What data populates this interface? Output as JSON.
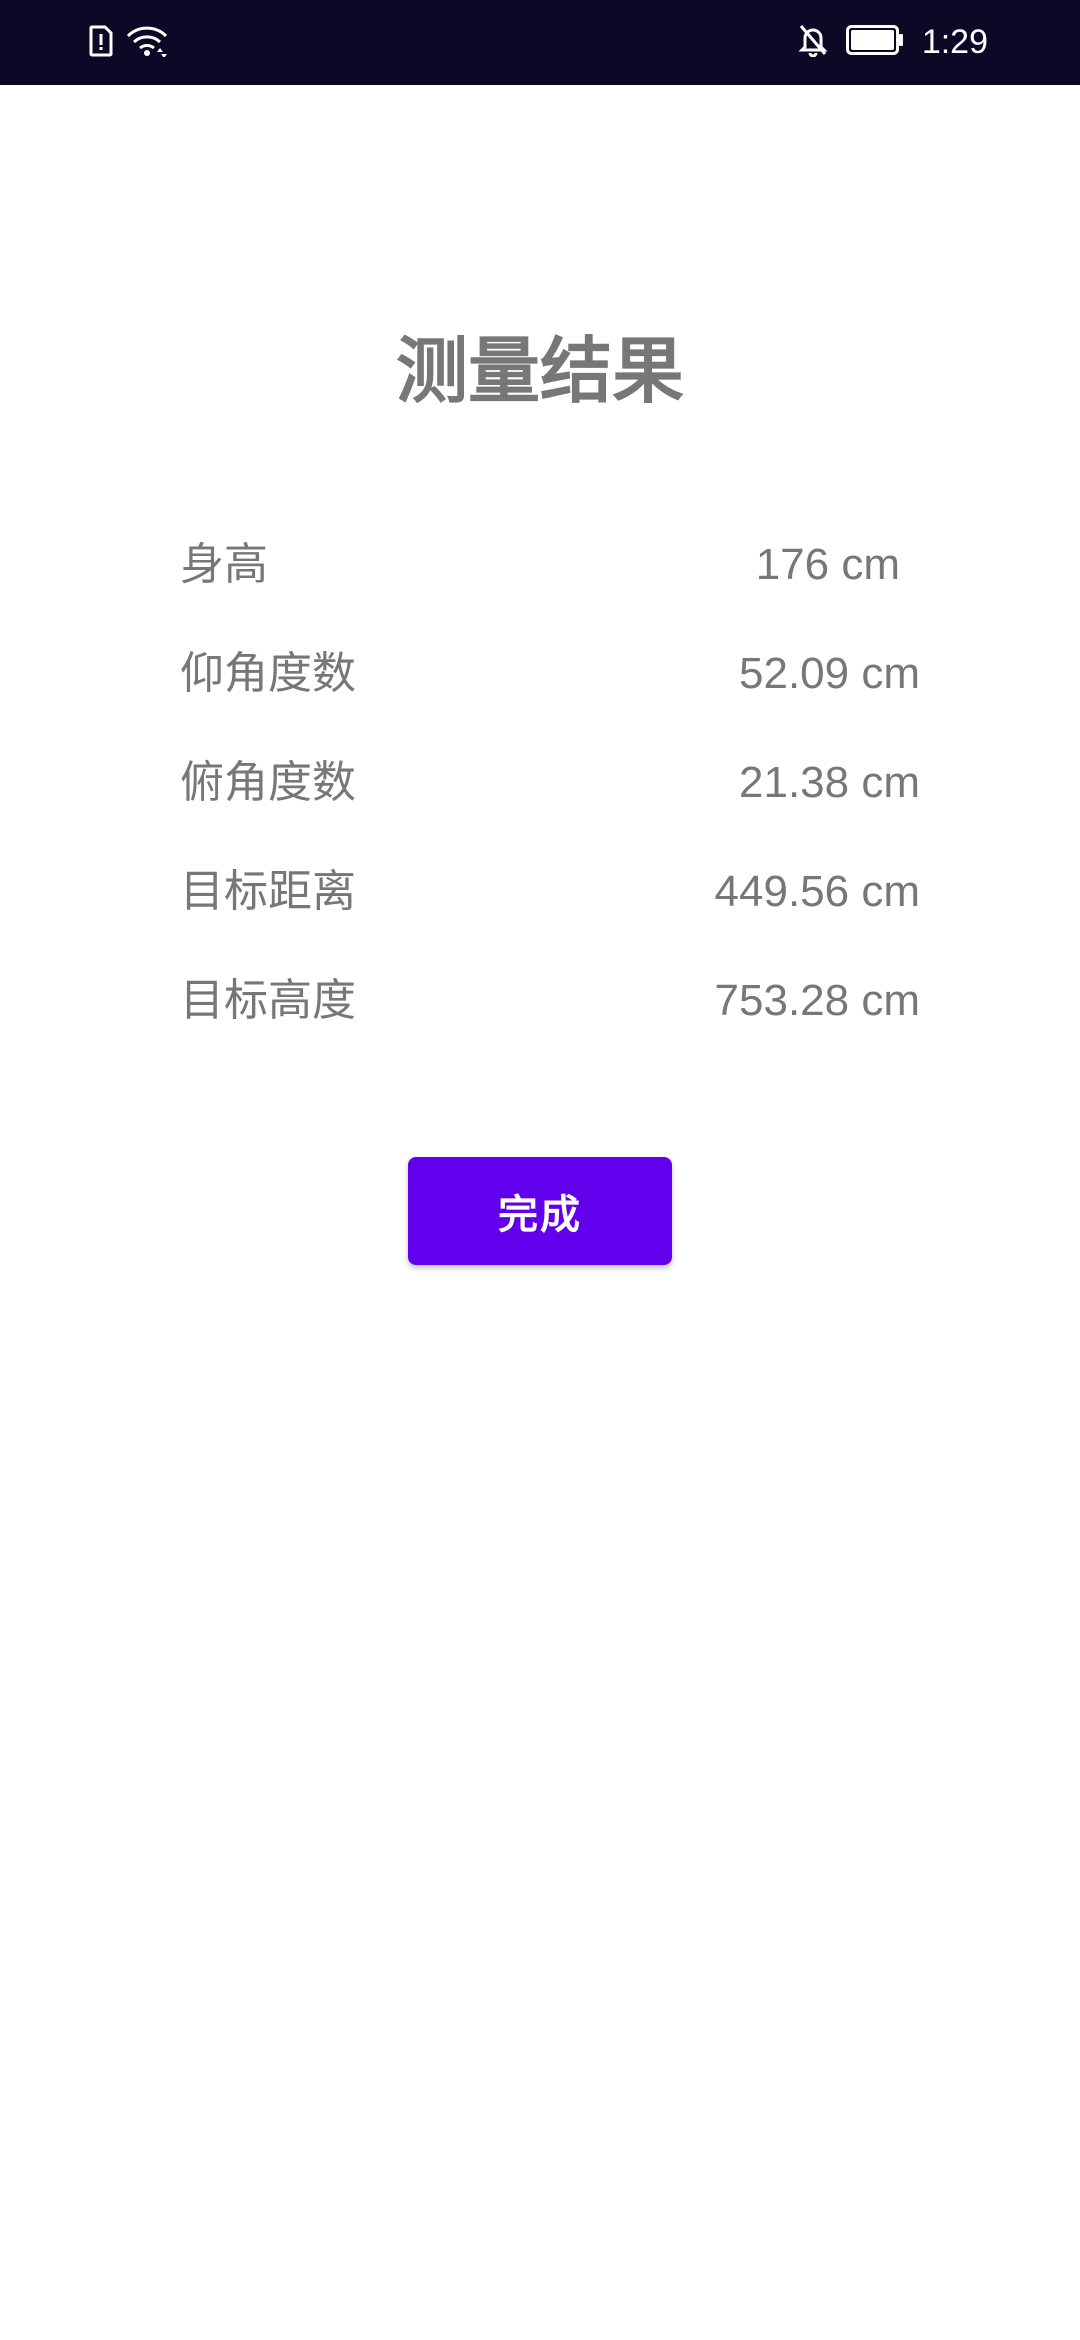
{
  "status_bar": {
    "time": "1:29",
    "icons": [
      "sim-alert-icon",
      "wifi-icon",
      "notifications-off-icon",
      "battery-icon"
    ]
  },
  "page": {
    "title": "测量结果",
    "results": [
      {
        "label": "身高",
        "value": "176 cm"
      },
      {
        "label": "仰角度数",
        "value": "52.09 cm"
      },
      {
        "label": "俯角度数",
        "value": "21.38 cm"
      },
      {
        "label": "目标距离",
        "value": "449.56 cm"
      },
      {
        "label": "目标高度",
        "value": "753.28 cm"
      }
    ],
    "done_button_label": "完成"
  },
  "colors": {
    "status_bar_bg": "#0d0826",
    "text_gray": "#777777",
    "accent": "#6200ee"
  }
}
